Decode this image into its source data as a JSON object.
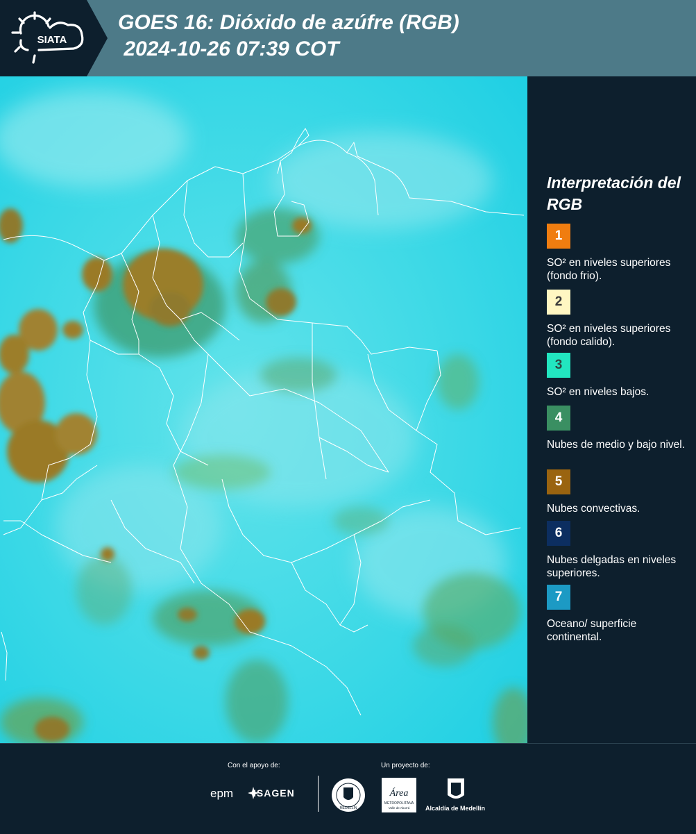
{
  "header": {
    "logo_text": "SIATA",
    "title_line1": "GOES 16: Dióxido de azúfre (RGB)",
    "title_line2": " 2024-10-26 07:39 COT"
  },
  "legend": {
    "title": "Interpretación del RGB",
    "items": [
      {
        "num": "1",
        "color": "#f07d10",
        "num_color": "#ffffff",
        "text": "SO² en niveles superiores (fondo frio)."
      },
      {
        "num": "2",
        "color": "#fff7c2",
        "num_color": "#3a3a3a",
        "text": "SO² en niveles superiores (fondo calido)."
      },
      {
        "num": "3",
        "color": "#22e6c0",
        "num_color": "#2d4a46",
        "text": "SO² en niveles bajos."
      },
      {
        "num": "4",
        "color": "#3a8f62",
        "num_color": "#ffffff",
        "text": "Nubes de medio y bajo nivel."
      },
      {
        "num": "5",
        "color": "#9a6410",
        "num_color": "#ffffff",
        "text": "Nubes convectivas."
      },
      {
        "num": "6",
        "color": "#0c2e60",
        "num_color": "#ffffff",
        "text": "Nubes delgadas en niveles superiores."
      },
      {
        "num": "7",
        "color": "#1c9ac4",
        "num_color": "#ffffff",
        "text": "Oceano/ superficie continental."
      }
    ]
  },
  "footer": {
    "support_label": "Con el apoyo de:",
    "project_label": "Un proyecto de:",
    "sponsor1": "epm",
    "sponsor2": "ISAGEN",
    "logo_area_name": "Área",
    "logo_area_sub": "METROPOLITANA",
    "logo_area_sub2": "Valle de Aburrá",
    "logo_alcaldia": "Alcaldía de Medellín",
    "logo_medellin": "MEDELLÍN"
  },
  "map": {
    "colors": {
      "background": "#36d8e6",
      "low_level_cloud": "#4c9f6a",
      "convective_cloud": "#9a7a28",
      "borders": "#ffffff"
    }
  }
}
